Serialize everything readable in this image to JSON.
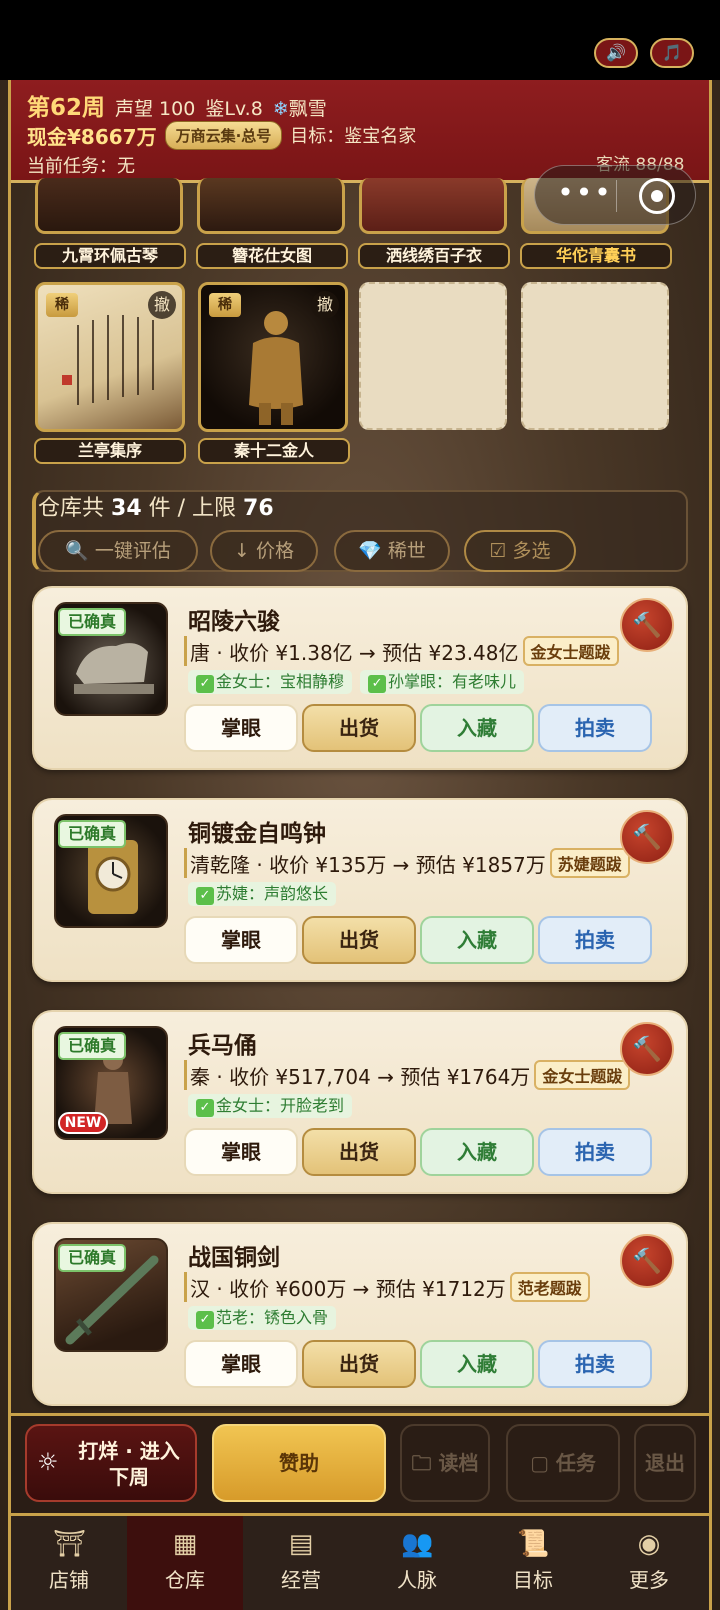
{
  "header": {
    "week": "第62周",
    "reputation": "声望 100",
    "appraisal_level": "鉴Lv.8",
    "weather_icon": "❄",
    "weather": "飘雪",
    "cash": "现金¥8667万",
    "shop_badge": "万商云集·总号",
    "goal": "目标：鉴宝名家",
    "task": "当前任务：无",
    "sound_icon": "🔊",
    "music_icon": "🎵",
    "traffic": "客流 88/88"
  },
  "showcase": {
    "row1": [
      {
        "label": "九霄环佩古琴",
        "rare": false
      },
      {
        "label": "簪花仕女图",
        "rare": false
      },
      {
        "label": "洒线绣百子衣",
        "rare": false
      },
      {
        "label": "华佗青囊书",
        "rare": true
      }
    ],
    "row2": [
      {
        "label": "兰亭集序",
        "tag": "稀",
        "undo": "撤"
      },
      {
        "label": "秦十二金人",
        "tag": "稀",
        "undo": "撤"
      }
    ]
  },
  "warehouse": {
    "count_prefix": "仓库共",
    "count": "34",
    "count_mid": "件 / 上限",
    "limit": "76",
    "filters": {
      "appraise": "🔍 一键评估",
      "price": "↓ 价格",
      "rare": "💎 稀世",
      "multi": "☑ 多选"
    }
  },
  "items": [
    {
      "title": "昭陵六骏",
      "auth": "已确真",
      "price": "唐 · 收价 ¥1.38亿 → 预估 ¥23.48亿",
      "badge": "金女士题跋",
      "comments": [
        "金女士：宝相静穆",
        "孙掌眼：有老味儿"
      ],
      "new": ""
    },
    {
      "title": "铜镀金自鸣钟",
      "auth": "已确真",
      "price": "清乾隆 · 收价 ¥135万 → 预估 ¥1857万",
      "badge": "苏婕题跋",
      "comments": [
        "苏婕：声韵悠长"
      ],
      "new": ""
    },
    {
      "title": "兵马俑",
      "auth": "已确真",
      "price": "秦 · 收价 ¥517,704 → 预估 ¥1764万",
      "badge": "金女士题跋",
      "comments": [
        "金女士：开脸老到"
      ],
      "new": "NEW"
    },
    {
      "title": "战国铜剑",
      "auth": "已确真",
      "price": "汉 · 收价 ¥600万 → 预估 ¥1712万",
      "badge": "范老题跋",
      "comments": [
        "范老：锈色入骨"
      ],
      "new": ""
    }
  ],
  "item_actions": {
    "eye": "掌眼",
    "ship": "出货",
    "keep": "入藏",
    "auction": "拍卖"
  },
  "actions": {
    "next_week": "打烊 · 进入下周",
    "sponsor": "赞助",
    "load": "读档",
    "task": "任务",
    "exit": "退出"
  },
  "tabs": [
    {
      "label": "店铺",
      "icon": "shop-icon"
    },
    {
      "label": "仓库",
      "icon": "warehouse-icon",
      "active": true
    },
    {
      "label": "经营",
      "icon": "abacus-icon"
    },
    {
      "label": "人脉",
      "icon": "people-icon"
    },
    {
      "label": "目标",
      "icon": "scroll-icon"
    },
    {
      "label": "更多",
      "icon": "more-icon"
    }
  ],
  "colors": {
    "header_red": "#8e1d1f",
    "gold": "#c9a24a",
    "card_bg": "#f7eedc"
  }
}
